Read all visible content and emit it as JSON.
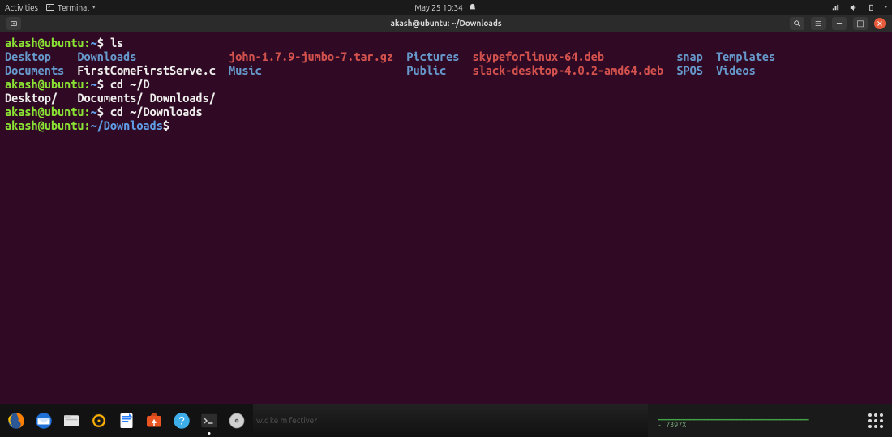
{
  "topbar": {
    "activities": "Activities",
    "app_menu": "Terminal",
    "clock": "May 25  10:34"
  },
  "window": {
    "title": "akash@ubuntu: ~/Downloads"
  },
  "terminal": {
    "prompt1": {
      "userhost": "akash@ubuntu:",
      "path": "~",
      "cmd": "ls"
    },
    "ls_cols": [
      [
        "Desktop",
        "Downloads",
        "john-1.7.9-jumbo-7.tar.gz",
        "Pictures",
        "skypeforlinux-64.deb",
        "snap",
        "Templates"
      ],
      [
        "Documents",
        "FirstComeFirstServe.c",
        "Music",
        "Public",
        "slack-desktop-4.0.2-amd64.deb",
        "SPOS",
        "Videos"
      ]
    ],
    "prompt2": {
      "userhost": "akash@ubuntu:",
      "path": "~",
      "cmd": "cd ~/D"
    },
    "completion": [
      "Desktop/",
      "Documents/",
      "Downloads/"
    ],
    "prompt3": {
      "userhost": "akash@ubuntu:",
      "path": "~",
      "cmd": "cd ~/Downloads"
    },
    "prompt4": {
      "userhost": "akash@ubuntu:",
      "path": "~/Downloads",
      "cmd": ""
    }
  },
  "dock": {
    "items": [
      {
        "name": "firefox"
      },
      {
        "name": "thunderbird"
      },
      {
        "name": "files"
      },
      {
        "name": "rhythmbox"
      },
      {
        "name": "libreoffice-writer"
      },
      {
        "name": "software-center"
      },
      {
        "name": "help"
      },
      {
        "name": "terminal",
        "running": true
      },
      {
        "name": "disc"
      }
    ],
    "faded_text": "w.c        ke         m      fective?"
  },
  "syspanel": {
    "sparkline": "▁▁▁▁▁▁▁▁▁▁▁▁▁▁▁▁▁▁▁▁▁▁▁▁▁▁▁▁▁▁▁▁▁▁▁▁▁▁▁▁▁▁",
    "line2": "-  7397X"
  }
}
